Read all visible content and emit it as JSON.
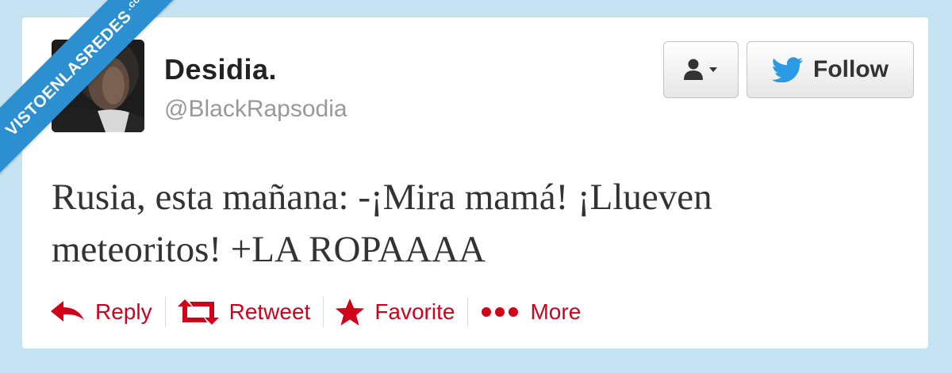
{
  "profile": {
    "display_name": "Desidia.",
    "handle": "@BlackRapsodia"
  },
  "buttons": {
    "user_menu_icon": "user-icon",
    "follow_label": "Follow",
    "follow_icon": "twitter-bird-icon"
  },
  "tweet": {
    "line1": "Rusia, esta mañana: -¡Mira mamá! ¡Llueven",
    "line2": "meteoritos! +LA ROPAAAA"
  },
  "actions": [
    {
      "label": "Reply",
      "icon": "reply-icon"
    },
    {
      "label": "Retweet",
      "icon": "retweet-icon"
    },
    {
      "label": "Favorite",
      "icon": "star-icon"
    },
    {
      "label": "More",
      "icon": "more-dots-icon"
    }
  ],
  "watermark": {
    "text": "VISTOENLASREDES",
    "sub": ".com"
  },
  "colors": {
    "background": "#c6e3f4",
    "action_red": "#d0021b",
    "twitter_blue": "#2b9be6",
    "banner_blue": "#2b8fd0"
  }
}
